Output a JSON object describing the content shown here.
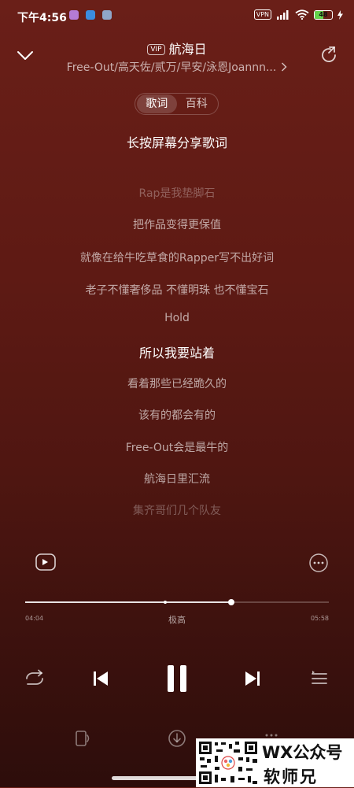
{
  "status_bar": {
    "time": "下午4:56",
    "vpn": "VPN",
    "battery_level": 48,
    "battery_text": "48",
    "icons": [
      "app-icon-1",
      "app-icon-2",
      "app-icon-3",
      "signal-icon",
      "wifi-icon",
      "charging-icon"
    ]
  },
  "header": {
    "vip": "VIP",
    "title": "航海日",
    "artists": "Free-Out/高天佐/贰万/早安/泳恩Joannn...",
    "collapse_icon": "chevron-down-icon",
    "share_icon": "share-icon"
  },
  "tabs": [
    {
      "label": "歌词",
      "active": true
    },
    {
      "label": "百科",
      "active": false
    }
  ],
  "share_hint": "长按屏幕分享歌词",
  "lyrics": [
    {
      "text": "Rap是我垫脚石",
      "state": "faded"
    },
    {
      "text": "把作品变得更保值",
      "state": "past"
    },
    {
      "text": "就像在给牛吃草食的Rapper写不出好词",
      "state": "past"
    },
    {
      "text": "老子不懂奢侈品 不懂明珠 也不懂宝石",
      "state": "past"
    },
    {
      "text": "Hold",
      "state": "past"
    },
    {
      "text": "所以我要站着",
      "state": "current"
    },
    {
      "text": "看着那些已经跪久的",
      "state": "upcoming"
    },
    {
      "text": "该有的都会有的",
      "state": "upcoming"
    },
    {
      "text": "Free-Out会是最牛的",
      "state": "upcoming"
    },
    {
      "text": "航海日里汇流",
      "state": "upcoming"
    },
    {
      "text": "集齐哥们几个队友",
      "state": "faded"
    }
  ],
  "progress": {
    "current_time": "04:04",
    "total_time": "05:58",
    "played_fraction": 0.68,
    "buffer_marker_fraction": 0.46,
    "quality": "极高"
  },
  "controls": {
    "loop_icon": "repeat-icon",
    "prev_icon": "previous-icon",
    "play_state_icon": "pause-icon",
    "next_icon": "next-icon",
    "playlist_icon": "playlist-icon"
  },
  "bottom_actions": [
    "device-icon",
    "download-icon",
    "more-horizontal-icon"
  ],
  "watermark": {
    "line1": "WX公众号",
    "line2": "软师兄"
  },
  "colors": {
    "background_top": "#6a1f18",
    "background_bottom": "#2d0d0b",
    "battery_green": "#63d04a"
  }
}
